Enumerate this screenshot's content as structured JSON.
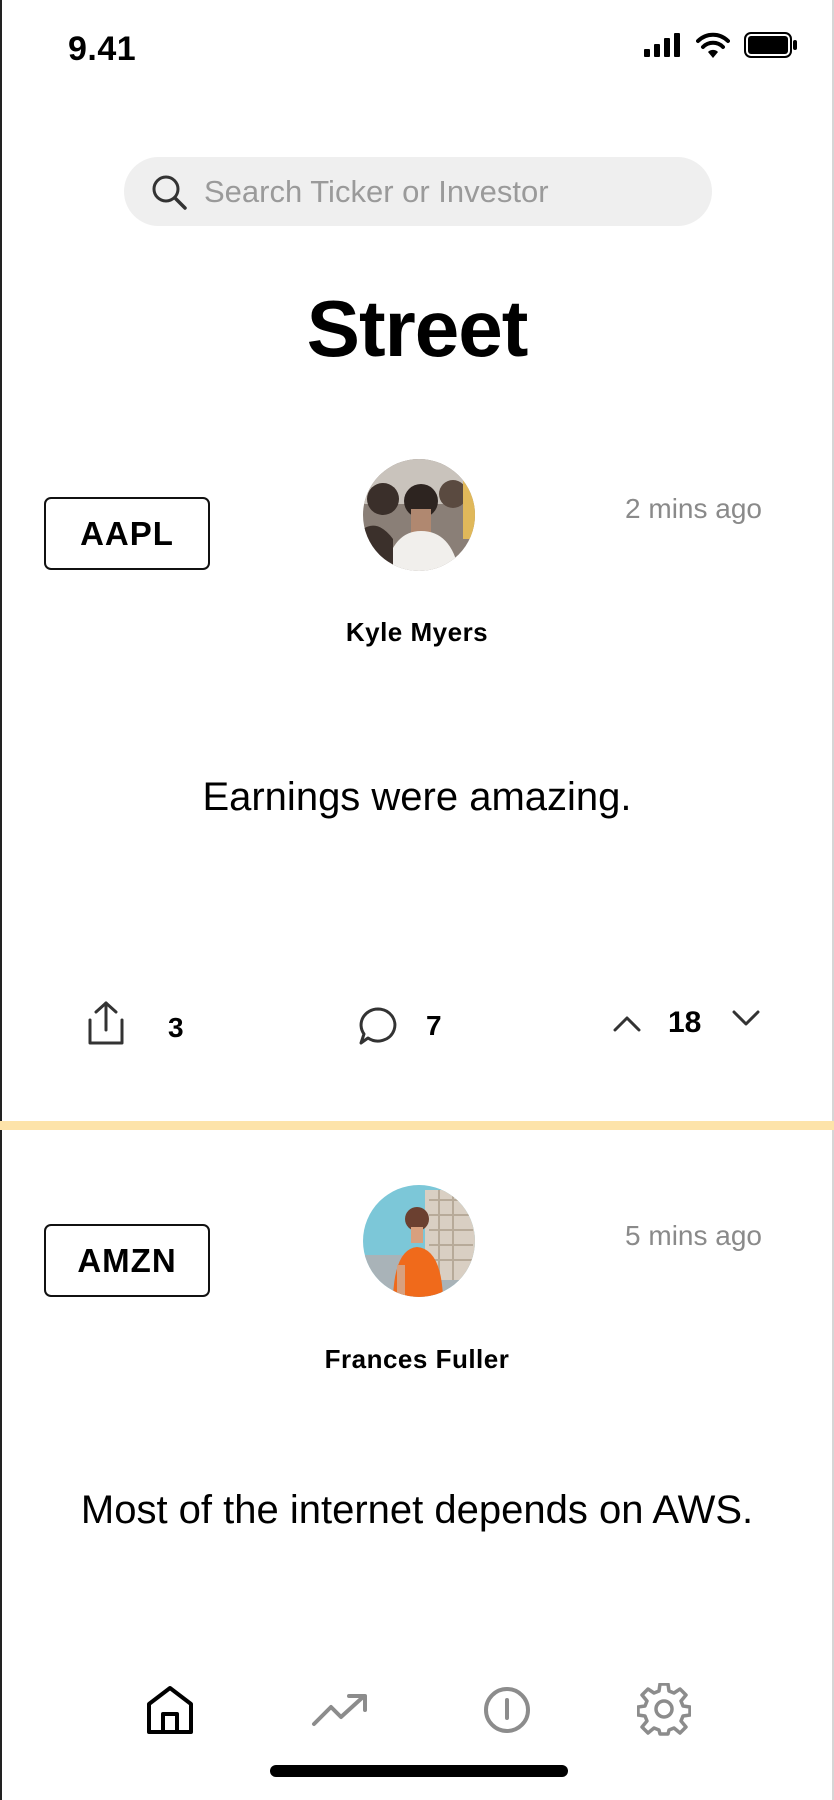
{
  "status_bar": {
    "time": "9.41"
  },
  "search": {
    "placeholder": "Search Ticker or Investor"
  },
  "page": {
    "title": "Street"
  },
  "posts": [
    {
      "ticker": "AAPL",
      "author": "Kyle Myers",
      "time_ago": "2 mins ago",
      "text": "Earnings were amazing.",
      "shares": "3",
      "comments": "7",
      "votes": "18"
    },
    {
      "ticker": "AMZN",
      "author": "Frances Fuller",
      "time_ago": "5 mins ago",
      "text": "Most of the internet depends on AWS."
    }
  ],
  "colors": {
    "divider": "#fde3a9",
    "search_bg": "#efefef",
    "muted_text": "#8a8a8a"
  },
  "tab_bar": {
    "items": [
      "home-icon",
      "trending-icon",
      "info-icon",
      "gear-icon"
    ],
    "active": "home-icon"
  }
}
